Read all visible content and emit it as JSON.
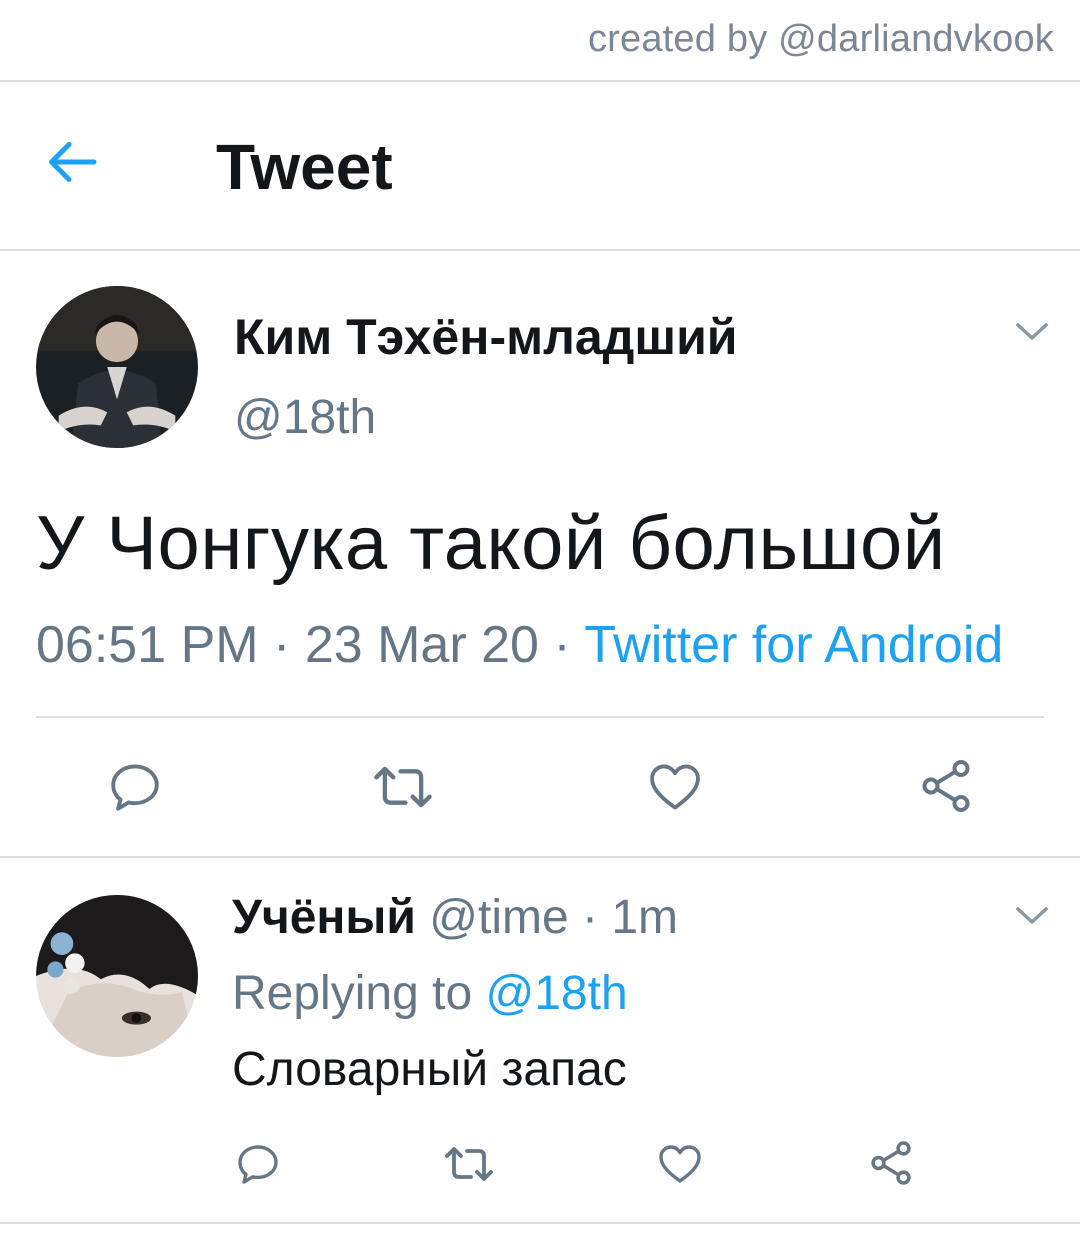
{
  "watermark": "created by @darliandvkook",
  "header": {
    "title": "Tweet",
    "back_icon": "arrow-left-icon"
  },
  "tweet": {
    "author_name": "Ким Тэхён-младший",
    "author_handle": "@18th",
    "text": "У Чонгука такой большой",
    "time": "06:51 PM",
    "date": "23 Mar 20",
    "source": "Twitter for Android",
    "sep": "·"
  },
  "reply": {
    "author_name": "Учёный",
    "author_handle": "@time",
    "sep": "·",
    "time": "1m",
    "replying_label": "Replying to",
    "replying_to": "@18th",
    "text": "Словарный запас"
  },
  "colors": {
    "accent": "#1da1f2",
    "secondary_text": "#657786",
    "icon": "#657786",
    "divider": "#d9dee3"
  },
  "icons": [
    "comment-icon",
    "retweet-icon",
    "like-icon",
    "share-icon",
    "chevron-down-icon"
  ]
}
